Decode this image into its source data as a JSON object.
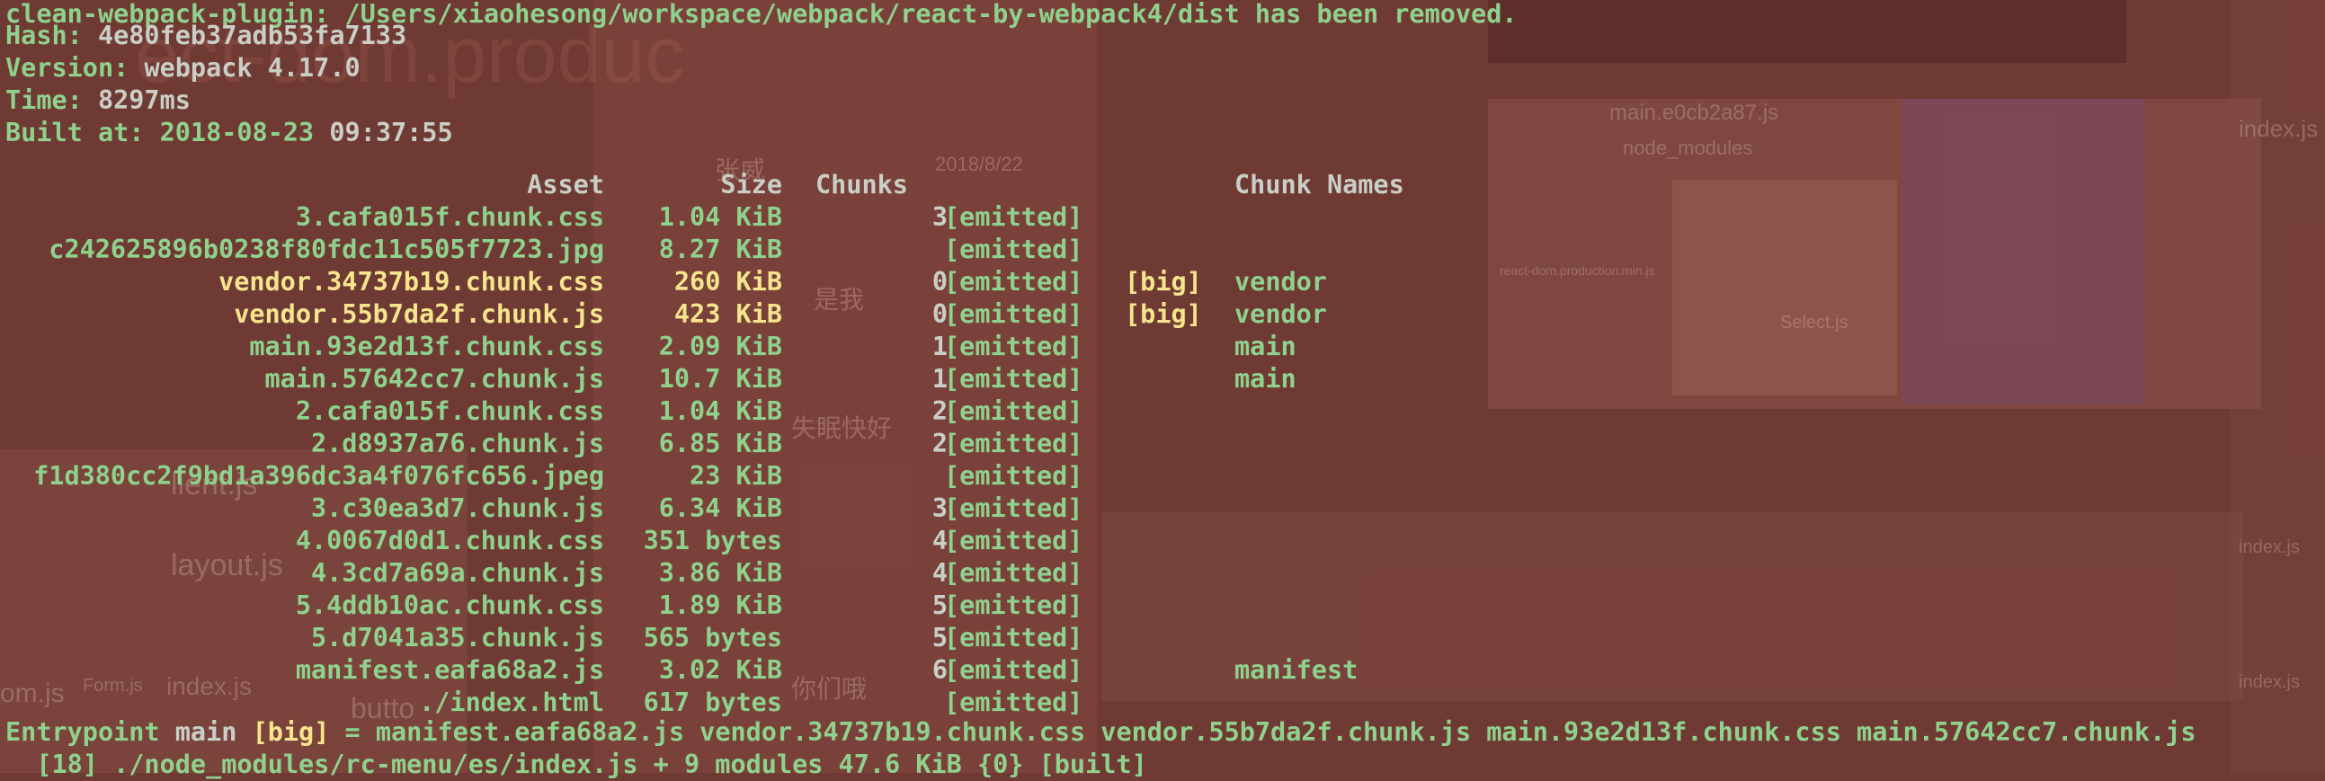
{
  "terminal": {
    "line1": "clean-webpack-plugin: /Users/xiaohesong/workspace/webpack/react-by-webpack4/dist has been removed.",
    "hash_label": "Hash: ",
    "hash_value": "4e80feb37adb53fa7133",
    "version_label": "Version: ",
    "version_value": "webpack 4.17.0",
    "time_label": "Time: ",
    "time_value": "8297ms",
    "built_label": "Built at: ",
    "built_date": "2018-08-23",
    "built_time": "09:37:55",
    "headers": {
      "asset": "Asset",
      "size": "Size",
      "chunks": "Chunks",
      "chunk_names": "Chunk Names"
    },
    "assets": [
      {
        "asset": "3.cafa015f.chunk.css",
        "size": "1.04 KiB",
        "chunks": "3",
        "status": "[emitted]",
        "flag": "",
        "name": "",
        "big": false
      },
      {
        "asset": "c242625896b0238f80fdc11c505f7723.jpg",
        "size": "8.27 KiB",
        "chunks": "",
        "status": "[emitted]",
        "flag": "",
        "name": "",
        "big": false
      },
      {
        "asset": "vendor.34737b19.chunk.css",
        "size": "260 KiB",
        "chunks": "0",
        "status": "[emitted]",
        "flag": "[big]",
        "name": "vendor",
        "big": true
      },
      {
        "asset": "vendor.55b7da2f.chunk.js",
        "size": "423 KiB",
        "chunks": "0",
        "status": "[emitted]",
        "flag": "[big]",
        "name": "vendor",
        "big": true
      },
      {
        "asset": "main.93e2d13f.chunk.css",
        "size": "2.09 KiB",
        "chunks": "1",
        "status": "[emitted]",
        "flag": "",
        "name": "main",
        "big": false
      },
      {
        "asset": "main.57642cc7.chunk.js",
        "size": "10.7 KiB",
        "chunks": "1",
        "status": "[emitted]",
        "flag": "",
        "name": "main",
        "big": false
      },
      {
        "asset": "2.cafa015f.chunk.css",
        "size": "1.04 KiB",
        "chunks": "2",
        "status": "[emitted]",
        "flag": "",
        "name": "",
        "big": false
      },
      {
        "asset": "2.d8937a76.chunk.js",
        "size": "6.85 KiB",
        "chunks": "2",
        "status": "[emitted]",
        "flag": "",
        "name": "",
        "big": false
      },
      {
        "asset": "f1d380cc2f9bd1a396dc3a4f076fc656.jpeg",
        "size": "23 KiB",
        "chunks": "",
        "status": "[emitted]",
        "flag": "",
        "name": "",
        "big": false
      },
      {
        "asset": "3.c30ea3d7.chunk.js",
        "size": "6.34 KiB",
        "chunks": "3",
        "status": "[emitted]",
        "flag": "",
        "name": "",
        "big": false
      },
      {
        "asset": "4.0067d0d1.chunk.css",
        "size": "351 bytes",
        "chunks": "4",
        "status": "[emitted]",
        "flag": "",
        "name": "",
        "big": false
      },
      {
        "asset": "4.3cd7a69a.chunk.js",
        "size": "3.86 KiB",
        "chunks": "4",
        "status": "[emitted]",
        "flag": "",
        "name": "",
        "big": false
      },
      {
        "asset": "5.4ddb10ac.chunk.css",
        "size": "1.89 KiB",
        "chunks": "5",
        "status": "[emitted]",
        "flag": "",
        "name": "",
        "big": false
      },
      {
        "asset": "5.d7041a35.chunk.js",
        "size": "565 bytes",
        "chunks": "5",
        "status": "[emitted]",
        "flag": "",
        "name": "",
        "big": false
      },
      {
        "asset": "manifest.eafa68a2.js",
        "size": "3.02 KiB",
        "chunks": "6",
        "status": "[emitted]",
        "flag": "",
        "name": "manifest",
        "big": false
      },
      {
        "asset": "./index.html",
        "size": "617 bytes",
        "chunks": "",
        "status": "[emitted]",
        "flag": "",
        "name": "",
        "big": false
      }
    ],
    "entrypoint_label": "Entrypoint ",
    "entrypoint_name": "main",
    "entrypoint_flag": "[big]",
    "entrypoint_files": "= manifest.eafa68a2.js vendor.34737b19.chunk.css vendor.55b7da2f.chunk.js main.93e2d13f.chunk.css main.57642cc7.chunk.js",
    "last_line": "  [18] ./node_modules/rc-menu/es/index.js + 9 modules 47.6 KiB {0} [built]"
  },
  "background": {
    "ghost_texts": [
      "main.e0cb2a87.js",
      "node_modules",
      "layout.js",
      "index.js",
      "Form.js",
      "om.js",
      "butto",
      "Select.js",
      "index.js",
      "index.js",
      "index.js",
      "失眠快好",
      "张威",
      "是我",
      "2018/8/22",
      "你们哦",
      "react-dom.production.min.js",
      "lient.js"
    ]
  }
}
